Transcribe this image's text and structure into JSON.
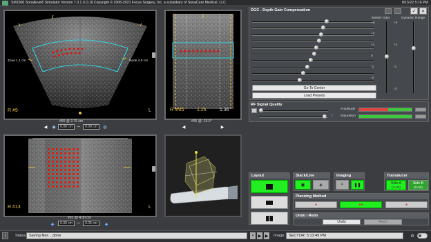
{
  "window": {
    "title": "SM1000 Sonalleve® Simulator Version 7.0.1.0 [1.0] Copyright © 2006-2021 Focus Surgery, Inc. a subsidiary of SonaCare Medical, LLC",
    "datetime": "8/15/22 5:16 PM"
  },
  "views": {
    "top_left": {
      "frame": "#9",
      "left_label": "Zone 1.1 cm",
      "right_label": "Node 4.0 cm",
      "marker_left": "R",
      "marker_right": "L",
      "caption": "#55 @ 2.75 cm",
      "field_left": "0.00 cm",
      "field_right": "0.00 cm"
    },
    "top_right": {
      "frame": "#M5",
      "value_a": "1.26",
      "value_b": "1.36",
      "marker_left": "R",
      "caption": "#55 @ -15.0°"
    },
    "bottom_left": {
      "frame": "#13",
      "marker_left": "R",
      "marker_right": "L",
      "caption": "#91 @ 4.00 cm",
      "field_left": "0.00 cm",
      "field_right": "0.05 cm"
    }
  },
  "dgc": {
    "title": "DGC - Depth Gain Compensation",
    "master_gain_label": "Master Gain",
    "dynamic_range_label": "Dynamic Range",
    "scale": [
      "+3",
      "+2",
      "+1",
      "0",
      "-1",
      "-2",
      "-3"
    ],
    "sliders": [
      0.62,
      0.59,
      0.57,
      0.55,
      0.53,
      0.51,
      0.48,
      0.45,
      0.42,
      0.39
    ],
    "go_to_center": "Go To Center",
    "load_presets": "Load Presets"
  },
  "rf": {
    "title": "RF Signal Quality",
    "amplitude_label": "Amplitude",
    "saturation_label": "Saturation"
  },
  "controls": {
    "layout_title": "Layout",
    "stack_title": "Stack/Live",
    "imaging_title": "Imaging",
    "transducer_title": "Transducer",
    "side_a": "Side A",
    "side_a_sub": "(4 cm)",
    "side_b": "Side B",
    "side_b_sub": "(3 cm)",
    "planning_title": "Planning Method",
    "undo_redo_title": "Undo / Redo",
    "undo": "Undo",
    "redo": "Redo"
  },
  "status": {
    "label": "Status:",
    "text": "Saving files ...done",
    "image_label": "Image:",
    "image_text": "SECTOR: 5:13:49 PM"
  }
}
